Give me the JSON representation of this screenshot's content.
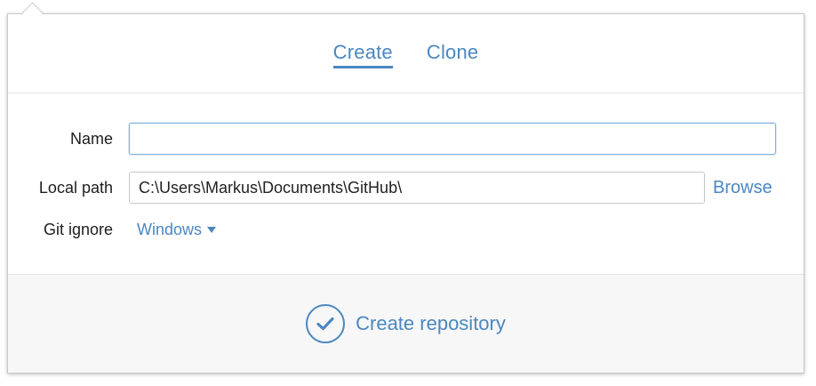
{
  "tabs": [
    {
      "label": "Create",
      "active": true
    },
    {
      "label": "Clone",
      "active": false
    }
  ],
  "form": {
    "name_label": "Name",
    "name_value": "",
    "local_path_label": "Local path",
    "local_path_value": "C:\\Users\\Markus\\Documents\\GitHub\\",
    "browse_label": "Browse",
    "git_ignore_label": "Git ignore",
    "git_ignore_value": "Windows"
  },
  "footer": {
    "create_label": "Create repository",
    "icon": "checkmark-icon"
  },
  "colors": {
    "accent": "#4a87c0",
    "footer_bg": "#f7f7f7"
  }
}
